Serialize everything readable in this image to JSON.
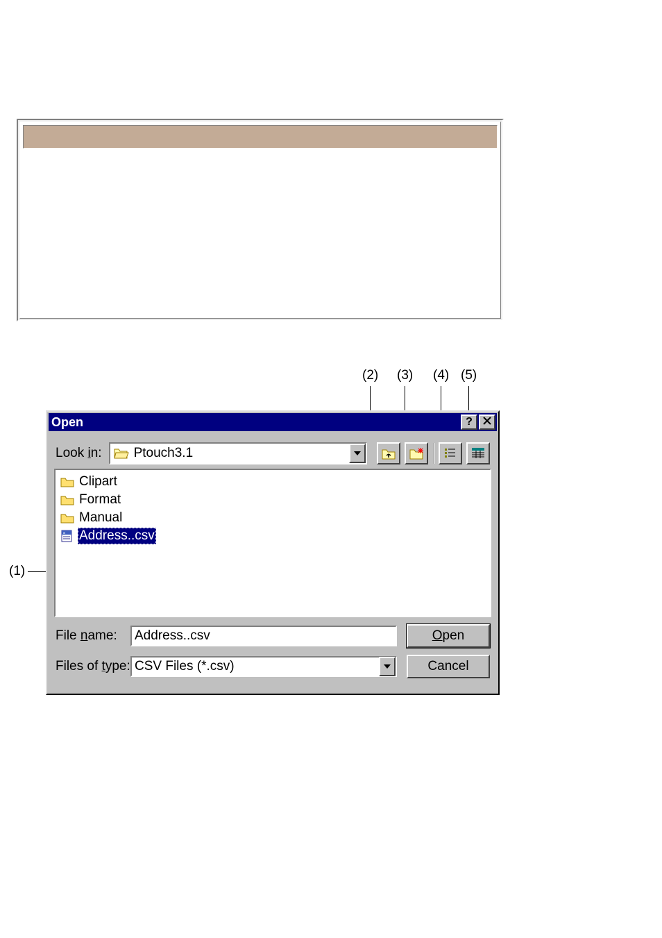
{
  "callouts": {
    "c1": "(1)",
    "c2": "(2)",
    "c3": "(3)",
    "c4": "(4)",
    "c5": "(5)"
  },
  "dialog": {
    "title": "Open",
    "lookin_label_pre": "Look ",
    "lookin_label_u": "i",
    "lookin_label_post": "n:",
    "lookin_value": "Ptouch3.1",
    "files": [
      {
        "name": "Clipart",
        "type": "folder",
        "selected": false
      },
      {
        "name": "Format",
        "type": "folder",
        "selected": false
      },
      {
        "name": "Manual",
        "type": "folder",
        "selected": false
      },
      {
        "name": "Address..csv",
        "type": "csv",
        "selected": true
      }
    ],
    "filename_label_pre": "File ",
    "filename_label_u": "n",
    "filename_label_post": "ame:",
    "filename_value": "Address..csv",
    "filetype_label_pre": "Files of ",
    "filetype_label_u": "t",
    "filetype_label_post": "ype:",
    "filetype_value": "CSV Files (*.csv)",
    "open_button_u": "O",
    "open_button_post": "pen",
    "cancel_button": "Cancel"
  }
}
